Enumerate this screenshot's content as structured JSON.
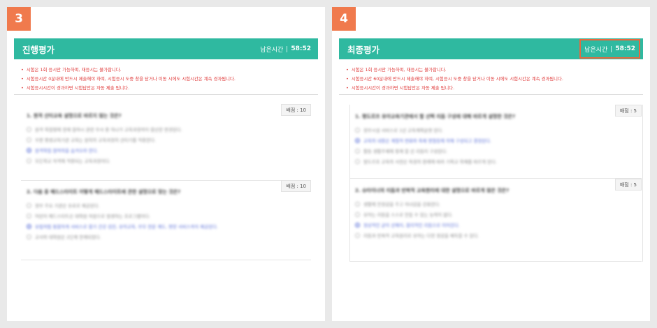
{
  "colors": {
    "header_bg": "#2fb9a0",
    "badge_bg": "#f07a4d",
    "notice_text": "#e03c3c",
    "highlight_border": "#e8683e",
    "selected_option": "#5a6fd8"
  },
  "panels": [
    {
      "step": "3",
      "title": "진행평가",
      "timer_label": "남은시간",
      "timer_value": "58:52",
      "notices": [
        "시험은 1회 응시만 가능하며, 재응시는 불가합니다.",
        "시험응시간 0분내에 반드시 제출해야 하며, 시험응시 도중 창을 닫거나 이동 시에도 시험시간은 계속 경과됩니다.",
        "시험응시시간이 경과하면 시험답안은 자동 제출 됩니다."
      ],
      "questions": [
        {
          "score": "배점 : 10",
          "text": "1. 원격 산타교육 설명으로 바르지 않는 것은?",
          "options": [
            "원격 학점형에 현재 참여시 관련 부서 중 하나가 교육과정까지 합산한 변경된다.",
            "우편 평생교육기관 교육는 원칙의 교육과정의 산타기를 적용한다.",
            "원격학점 참여작을 숨겨오라 한다.",
            "모든학교 자격에 적용되는 교육과정이다."
          ]
        },
        {
          "score": "배점 : 10",
          "text": "2. 다음 중 헤드스타이트 어떻게 헤드스타이트에 관한 설명으로 맞는 것은?",
          "options": [
            "정부 주요 기관은 유료로 제공된다.",
            "어린이 헤드스타트은 대학원 자원으로 발생하는 프로그램이다.",
            "유럽처럼 통합하게 서비스로 합기 건강 검진, 유아교육, 부모 전문 계도, 영양 서비스까지 제공된다.",
            "교사와 대학원은 2단계 연계되었다."
          ]
        }
      ]
    },
    {
      "step": "4",
      "title": "최종평가",
      "timer_label": "남은시간",
      "timer_value": "58:52",
      "notices": [
        "시험은 1회 응시만 가능하며, 재응시는 불가합니다.",
        "시험응시간 60분내에 반드시 제출해야 하며, 시험응시 도중 창을 닫거나 이동 시에도 시험시간은 계속 경과됩니다.",
        "시험응시시간이 경과하면 시험답안은 자동 제출 됩니다."
      ],
      "questions": [
        {
          "score": "배점 : 5",
          "text": "1. 평도르프 유아교육기관에서 할 선택 리듬 구성에 대해 바르게 설명한 것은?",
          "options": [
            "정부시설 서비스로 1년 교육계획운영 된다.",
            "교육의 내용은 계절적 변화와 축제 명절등에 의해 구성되고 결정된다.",
            "활동 생활주제에 항계 할 선 리듬이 구성된다.",
            "발도르프 교육의 사전은 특정의 판례에 따라 기획교 학제를 따르게 된다."
          ]
        },
        {
          "score": "배점 : 5",
          "text": "2. 슈타이너의 리듬과 반복적 교육원리에 대한 설명으로 바르게 않은 것은?",
          "options": [
            "생활에 안정감을 주고 자녀감을 강화한다.",
            "유아는 리듬을 스스로 만들 수 있는 능력이 없다.",
            "정상적인 균이 선해지, 합리적인 리듬으로 이어진다.",
            "리듬과 반복적 교육원리로 유아는 다양 정감을 체득할 수 있다."
          ]
        }
      ]
    }
  ]
}
